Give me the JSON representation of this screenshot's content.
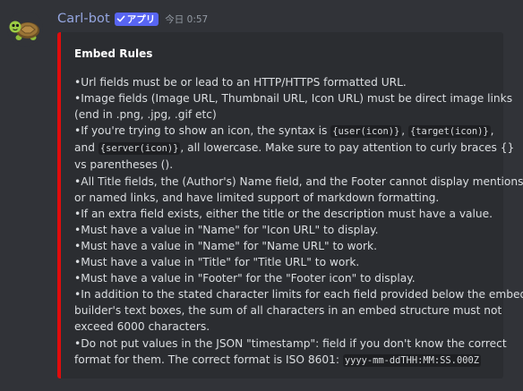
{
  "message": {
    "username": "Carl-bot",
    "app_tag": "アプリ",
    "timestamp": "今日 0:57"
  },
  "embed": {
    "accent_color": "#e00c0c",
    "title": "Embed Rules",
    "lines": [
      {
        "parts": [
          {
            "t": "•Url fields must be or lead to an HTTP/HTTPS formatted URL."
          }
        ]
      },
      {
        "parts": [
          {
            "t": "•Image fields (Image URL, Thumbnail URL, Icon URL) must be direct image links"
          }
        ]
      },
      {
        "parts": [
          {
            "t": "(end in .png, .jpg, .gif etc)"
          }
        ]
      },
      {
        "parts": [
          {
            "t": "•If you're trying to show an icon, the syntax is "
          },
          {
            "c": "{user(icon)}"
          },
          {
            "t": ", "
          },
          {
            "c": "{target(icon)}"
          },
          {
            "t": ","
          }
        ]
      },
      {
        "parts": [
          {
            "t": "and "
          },
          {
            "c": "{server(icon)}"
          },
          {
            "t": ", all lowercase. Make sure to pay attention to curly braces {}"
          }
        ]
      },
      {
        "parts": [
          {
            "t": "vs parentheses ()."
          }
        ]
      },
      {
        "parts": [
          {
            "t": "•All Title fields, the (Author's) Name field, and the Footer cannot display mentions"
          }
        ]
      },
      {
        "parts": [
          {
            "t": "or named links, and have limited support of markdown formatting."
          }
        ]
      },
      {
        "parts": [
          {
            "t": "•If an extra field exists, either the title or the description must have a value."
          }
        ]
      },
      {
        "parts": [
          {
            "t": "•Must have a value in \"Name\" for \"Icon URL\" to display."
          }
        ]
      },
      {
        "parts": [
          {
            "t": "•Must have a value in \"Name\" for \"Name URL\" to work."
          }
        ]
      },
      {
        "parts": [
          {
            "t": "•Must have a value in \"Title\" for \"Title URL\" to work."
          }
        ]
      },
      {
        "parts": [
          {
            "t": "•Must have a value in \"Footer\" for the \"Footer icon\" to display."
          }
        ]
      },
      {
        "parts": [
          {
            "t": "•In addition to the stated character limits for each field provided below the embed"
          }
        ]
      },
      {
        "parts": [
          {
            "t": "builder's text boxes, the sum of all characters in an embed structure must not"
          }
        ]
      },
      {
        "parts": [
          {
            "t": "exceed 6000 characters."
          }
        ]
      },
      {
        "parts": [
          {
            "t": "•Do not put values in the JSON \"timestamp\": field if you don't know the correct"
          }
        ]
      },
      {
        "parts": [
          {
            "t": "format for them. The correct format is ISO 8601: "
          },
          {
            "c": "yyyy-mm-ddTHH:MM:SS.000Z"
          }
        ]
      }
    ]
  },
  "icons": {
    "avatar": "turtle-icon",
    "verified": "check-icon"
  }
}
